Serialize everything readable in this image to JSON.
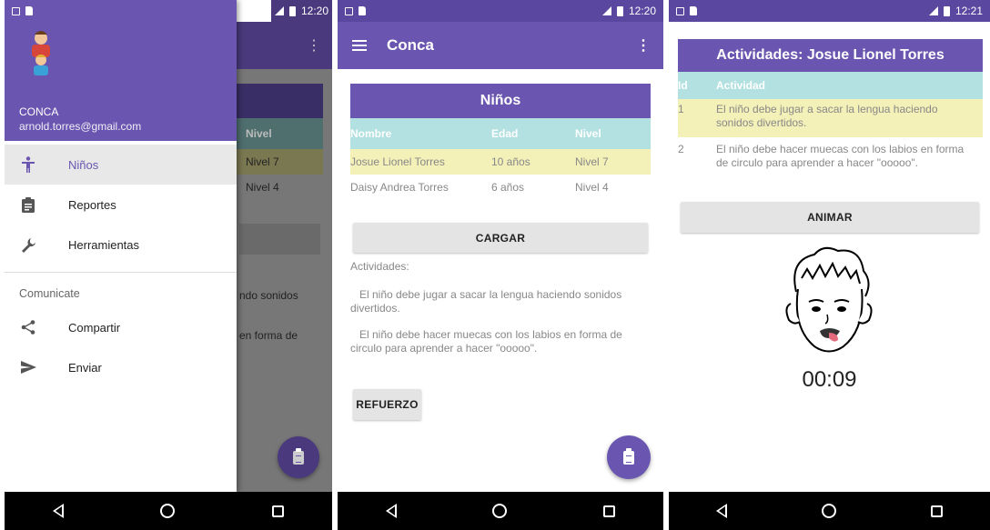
{
  "status": {
    "time1": "12:20",
    "time2": "12:20",
    "time3": "12:21",
    "network": "3G"
  },
  "drawer": {
    "name": "CONCA",
    "email": "arnold.torres@gmail.com",
    "items": [
      {
        "label": "Niños",
        "icon": "child-icon"
      },
      {
        "label": "Reportes",
        "icon": "clipboard-icon"
      },
      {
        "label": "Herramientas",
        "icon": "wrench-icon"
      }
    ],
    "section": "Comunicate",
    "section_items": [
      {
        "label": "Compartir",
        "icon": "share-icon"
      },
      {
        "label": "Enviar",
        "icon": "send-icon"
      }
    ],
    "behind": {
      "nivel_header": "Nivel",
      "row1": "Nivel 7",
      "row2": "Nivel 4",
      "text1": "ndo sonidos",
      "text2": "en forma de"
    }
  },
  "main": {
    "appbar_title": "Conca",
    "table": {
      "title": "Niños",
      "headers": [
        "Nombre",
        "Edad",
        "Nivel"
      ],
      "rows": [
        [
          "Josue Lionel Torres",
          "10 años",
          "Nivel 7"
        ],
        [
          "Daisy Andrea Torres",
          "6 años",
          "Nivel 4"
        ]
      ]
    },
    "load_button": "CARGAR",
    "activities_label": "Actividades:",
    "activity1": "El niño debe jugar a sacar la lengua haciendo sonidos divertidos.",
    "activity2": "El niño debe hacer muecas con los labios en forma de circulo para aprender a hacer \"ooooo\".",
    "reinforce_button": "REFUERZO"
  },
  "detail": {
    "title": "Actividades: Josue Lionel Torres",
    "headers": [
      "Id",
      "Actividad"
    ],
    "rows": [
      [
        "1",
        "El niño debe jugar a sacar la lengua haciendo sonidos divertidos."
      ],
      [
        "2",
        "El niño debe hacer muecas con los labios en forma de circulo para aprender a hacer \"ooooo\"."
      ]
    ],
    "animate_button": "ANIMAR",
    "timer": "00:09"
  },
  "colors": {
    "primary": "#6a56b0",
    "header_teal": "#b3e0e0",
    "highlight": "#f3f0b8"
  }
}
